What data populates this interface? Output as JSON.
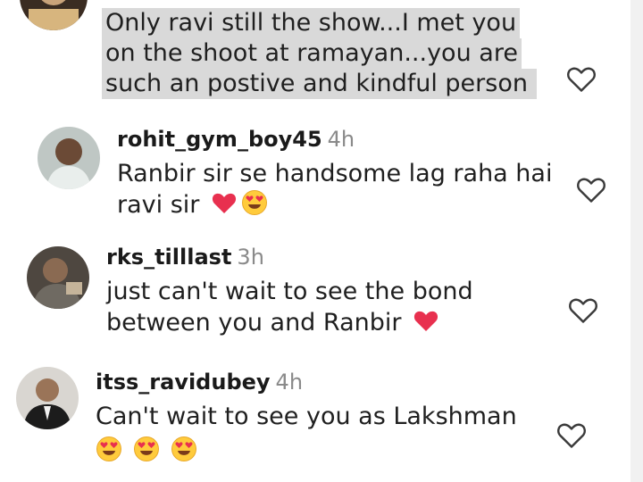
{
  "comments": [
    {
      "username": "",
      "time": "",
      "lines": [
        "Only ravi still the show...I met you",
        "on the shoot at ramayan...you are",
        "such an postive and kindful person"
      ],
      "avatar": "partial-avatar",
      "emojis": []
    },
    {
      "username": "rohit_gym_boy45",
      "time": "4h",
      "lines": [
        "Ranbir sir se handsome lag raha hai",
        "ravi sir"
      ],
      "avatar": "user-avatar",
      "emojis": [
        "red-heart",
        "heart-eyes-face"
      ]
    },
    {
      "username": "rks_tilllast",
      "time": "3h",
      "lines": [
        "just can't wait to see the bond",
        "between you and Ranbir"
      ],
      "avatar": "user-avatar",
      "emojis": [
        "red-heart"
      ]
    },
    {
      "username": "itss_ravidubey",
      "time": "4h",
      "lines": [
        "Can't wait to see you as Lakshman"
      ],
      "avatar": "user-avatar",
      "emojis": [
        "heart-eyes-face",
        "heart-eyes-face",
        "heart-eyes-face"
      ]
    }
  ],
  "icons": {
    "like": "heart-outline-icon"
  },
  "colors": {
    "highlight": "#d9d9d9",
    "username": "#1a1a1a",
    "timestamp": "#8a8a8a",
    "heart": "#e8304f"
  }
}
